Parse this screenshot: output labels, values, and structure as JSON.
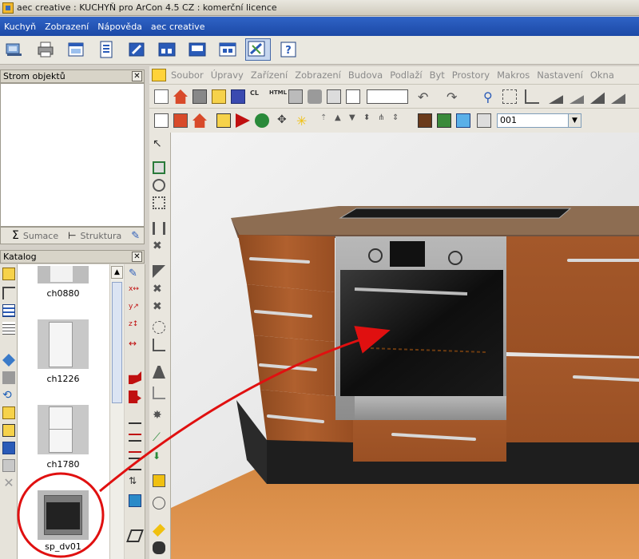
{
  "window": {
    "title": "aec creative : KUCHYŇ pro ArCon 4.5 CZ : komerční licence"
  },
  "menubar": {
    "items": [
      "Kuchyň",
      "Zobrazení",
      "Nápověda",
      "aec creative"
    ]
  },
  "main_toolbar": {
    "buttons": [
      {
        "name": "catalog-tool",
        "icon": "kitchen-icon"
      },
      {
        "name": "print-tool",
        "icon": "printer-icon"
      },
      {
        "name": "view-tool",
        "icon": "window-icon"
      },
      {
        "name": "list-tool",
        "icon": "document-list-icon"
      },
      {
        "name": "edit-tool",
        "icon": "pencil-icon"
      },
      {
        "name": "elevation-tool",
        "icon": "elevation-icon"
      },
      {
        "name": "panel-tool",
        "icon": "panel-icon"
      },
      {
        "name": "dialog-tool",
        "icon": "dialog-icon"
      },
      {
        "name": "arcon-tool",
        "icon": "arcon-icon",
        "active": true
      },
      {
        "name": "help-tool",
        "icon": "help-icon"
      }
    ]
  },
  "object_tree": {
    "title": "Strom objektů",
    "tabs": [
      {
        "label": "Sumace",
        "icon": "sigma-icon"
      },
      {
        "label": "Struktura",
        "icon": "tree-structure-icon"
      }
    ]
  },
  "catalog": {
    "title": "Katalog",
    "items": [
      {
        "label": "ch0880"
      },
      {
        "label": "ch1226"
      },
      {
        "label": "ch1780"
      },
      {
        "label": "sp_dv01",
        "highlighted": true
      }
    ]
  },
  "arcon": {
    "menu": [
      "Soubor",
      "Úpravy",
      "Zařízení",
      "Zobrazení",
      "Budova",
      "Podlaží",
      "Byt",
      "Prostory",
      "Makros",
      "Nastavení",
      "Okna"
    ],
    "level_value": "001"
  },
  "scene": {
    "annotation": "red-arrow-drag",
    "colors": {
      "wood": "#a5582a",
      "countertop": "#8a6a4e",
      "floor": "#d98a48",
      "wall": "#e6e6e6",
      "annotation": "#e01010"
    }
  }
}
